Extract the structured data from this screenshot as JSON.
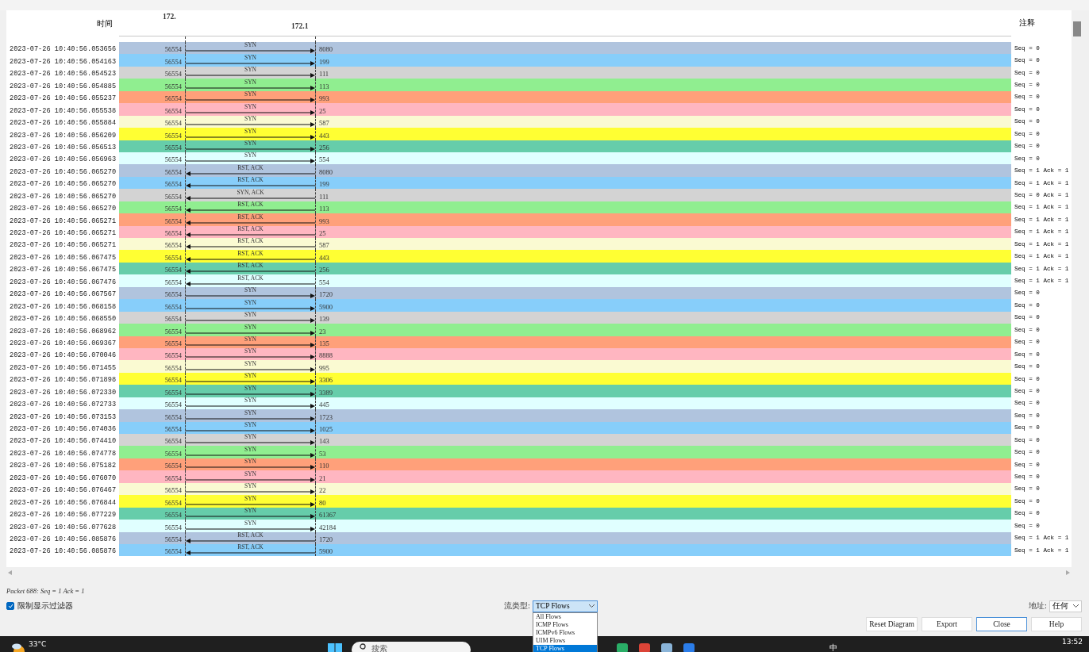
{
  "header": {
    "time_label": "时间",
    "hosts": [
      "172.",
      "172.1"
    ],
    "comment_label": "注释"
  },
  "flows": [
    {
      "time": "2023-07-26 10:40:56.053656",
      "src": "56554",
      "label": "SYN",
      "kind": "outbound",
      "dst": "8080",
      "comment": "Seq = 0",
      "color": "#b0c4de"
    },
    {
      "time": "2023-07-26 10:40:56.054163",
      "src": "56554",
      "label": "SYN",
      "kind": "outbound",
      "dst": "199",
      "comment": "Seq = 0",
      "color": "#87cefa"
    },
    {
      "time": "2023-07-26 10:40:56.054523",
      "src": "56554",
      "label": "SYN",
      "kind": "outbound",
      "dst": "111",
      "comment": "Seq = 0",
      "color": "#d3d3d3"
    },
    {
      "time": "2023-07-26 10:40:56.054885",
      "src": "56554",
      "label": "SYN",
      "kind": "outbound",
      "dst": "113",
      "comment": "Seq = 0",
      "color": "#90ee90"
    },
    {
      "time": "2023-07-26 10:40:56.055237",
      "src": "56554",
      "label": "SYN",
      "kind": "outbound",
      "dst": "993",
      "comment": "Seq = 0",
      "color": "#ffa07a"
    },
    {
      "time": "2023-07-26 10:40:56.055538",
      "src": "56554",
      "label": "SYN",
      "kind": "outbound",
      "dst": "25",
      "comment": "Seq = 0",
      "color": "#ffb6c1"
    },
    {
      "time": "2023-07-26 10:40:56.055884",
      "src": "56554",
      "label": "SYN",
      "kind": "outbound",
      "dst": "587",
      "comment": "Seq = 0",
      "color": "#fafad2"
    },
    {
      "time": "2023-07-26 10:40:56.056209",
      "src": "56554",
      "label": "SYN",
      "kind": "outbound",
      "dst": "443",
      "comment": "Seq = 0",
      "color": "#ffff33"
    },
    {
      "time": "2023-07-26 10:40:56.056513",
      "src": "56554",
      "label": "SYN",
      "kind": "outbound",
      "dst": "256",
      "comment": "Seq = 0",
      "color": "#66cdaa"
    },
    {
      "time": "2023-07-26 10:40:56.056963",
      "src": "56554",
      "label": "SYN",
      "kind": "outbound",
      "dst": "554",
      "comment": "Seq = 0",
      "color": "#e0ffff"
    },
    {
      "time": "2023-07-26 10:40:56.065270",
      "src": "56554",
      "label": "RST, ACK",
      "kind": "inbound",
      "dst": "8080",
      "comment": "Seq = 1 Ack = 1",
      "color": "#b0c4de"
    },
    {
      "time": "2023-07-26 10:40:56.065270",
      "src": "56554",
      "label": "RST, ACK",
      "kind": "inbound",
      "dst": "199",
      "comment": "Seq = 1 Ack = 1",
      "color": "#87cefa"
    },
    {
      "time": "2023-07-26 10:40:56.065270",
      "src": "56554",
      "label": "SYN, ACK",
      "kind": "inbound",
      "dst": "111",
      "comment": "Seq = 0 Ack = 1",
      "color": "#d3d3d3"
    },
    {
      "time": "2023-07-26 10:40:56.065270",
      "src": "56554",
      "label": "RST, ACK",
      "kind": "inbound",
      "dst": "113",
      "comment": "Seq = 1 Ack = 1",
      "color": "#90ee90"
    },
    {
      "time": "2023-07-26 10:40:56.065271",
      "src": "56554",
      "label": "RST, ACK",
      "kind": "inbound",
      "dst": "993",
      "comment": "Seq = 1 Ack = 1",
      "color": "#ffa07a"
    },
    {
      "time": "2023-07-26 10:40:56.065271",
      "src": "56554",
      "label": "RST, ACK",
      "kind": "inbound",
      "dst": "25",
      "comment": "Seq = 1 Ack = 1",
      "color": "#ffb6c1"
    },
    {
      "time": "2023-07-26 10:40:56.065271",
      "src": "56554",
      "label": "RST, ACK",
      "kind": "inbound",
      "dst": "587",
      "comment": "Seq = 1 Ack = 1",
      "color": "#fafad2"
    },
    {
      "time": "2023-07-26 10:40:56.067475",
      "src": "56554",
      "label": "RST, ACK",
      "kind": "inbound",
      "dst": "443",
      "comment": "Seq = 1 Ack = 1",
      "color": "#ffff33"
    },
    {
      "time": "2023-07-26 10:40:56.067475",
      "src": "56554",
      "label": "RST, ACK",
      "kind": "inbound",
      "dst": "256",
      "comment": "Seq = 1 Ack = 1",
      "color": "#66cdaa"
    },
    {
      "time": "2023-07-26 10:40:56.067476",
      "src": "56554",
      "label": "RST, ACK",
      "kind": "inbound",
      "dst": "554",
      "comment": "Seq = 1 Ack = 1",
      "color": "#e0ffff"
    },
    {
      "time": "2023-07-26 10:40:56.067567",
      "src": "56554",
      "label": "SYN",
      "kind": "outbound",
      "dst": "1720",
      "comment": "Seq = 0",
      "color": "#b0c4de"
    },
    {
      "time": "2023-07-26 10:40:56.068158",
      "src": "56554",
      "label": "SYN",
      "kind": "outbound",
      "dst": "5900",
      "comment": "Seq = 0",
      "color": "#87cefa"
    },
    {
      "time": "2023-07-26 10:40:56.068550",
      "src": "56554",
      "label": "SYN",
      "kind": "outbound",
      "dst": "139",
      "comment": "Seq = 0",
      "color": "#d3d3d3"
    },
    {
      "time": "2023-07-26 10:40:56.068962",
      "src": "56554",
      "label": "SYN",
      "kind": "outbound",
      "dst": "23",
      "comment": "Seq = 0",
      "color": "#90ee90"
    },
    {
      "time": "2023-07-26 10:40:56.069367",
      "src": "56554",
      "label": "SYN",
      "kind": "outbound",
      "dst": "135",
      "comment": "Seq = 0",
      "color": "#ffa07a"
    },
    {
      "time": "2023-07-26 10:40:56.070046",
      "src": "56554",
      "label": "SYN",
      "kind": "outbound",
      "dst": "8888",
      "comment": "Seq = 0",
      "color": "#ffb6c1"
    },
    {
      "time": "2023-07-26 10:40:56.071455",
      "src": "56554",
      "label": "SYN",
      "kind": "outbound",
      "dst": "995",
      "comment": "Seq = 0",
      "color": "#fafad2"
    },
    {
      "time": "2023-07-26 10:40:56.071898",
      "src": "56554",
      "label": "SYN",
      "kind": "outbound",
      "dst": "3306",
      "comment": "Seq = 0",
      "color": "#ffff33"
    },
    {
      "time": "2023-07-26 10:40:56.072330",
      "src": "56554",
      "label": "SYN",
      "kind": "outbound",
      "dst": "3389",
      "comment": "Seq = 0",
      "color": "#66cdaa"
    },
    {
      "time": "2023-07-26 10:40:56.072733",
      "src": "56554",
      "label": "SYN",
      "kind": "outbound",
      "dst": "445",
      "comment": "Seq = 0",
      "color": "#e0ffff"
    },
    {
      "time": "2023-07-26 10:40:56.073153",
      "src": "56554",
      "label": "SYN",
      "kind": "outbound",
      "dst": "1723",
      "comment": "Seq = 0",
      "color": "#b0c4de"
    },
    {
      "time": "2023-07-26 10:40:56.074036",
      "src": "56554",
      "label": "SYN",
      "kind": "outbound",
      "dst": "1025",
      "comment": "Seq = 0",
      "color": "#87cefa"
    },
    {
      "time": "2023-07-26 10:40:56.074410",
      "src": "56554",
      "label": "SYN",
      "kind": "outbound",
      "dst": "143",
      "comment": "Seq = 0",
      "color": "#d3d3d3"
    },
    {
      "time": "2023-07-26 10:40:56.074778",
      "src": "56554",
      "label": "SYN",
      "kind": "outbound",
      "dst": "53",
      "comment": "Seq = 0",
      "color": "#90ee90"
    },
    {
      "time": "2023-07-26 10:40:56.075182",
      "src": "56554",
      "label": "SYN",
      "kind": "outbound",
      "dst": "110",
      "comment": "Seq = 0",
      "color": "#ffa07a"
    },
    {
      "time": "2023-07-26 10:40:56.076070",
      "src": "56554",
      "label": "SYN",
      "kind": "outbound",
      "dst": "21",
      "comment": "Seq = 0",
      "color": "#ffb6c1"
    },
    {
      "time": "2023-07-26 10:40:56.076467",
      "src": "56554",
      "label": "SYN",
      "kind": "outbound",
      "dst": "22",
      "comment": "Seq = 0",
      "color": "#fafad2"
    },
    {
      "time": "2023-07-26 10:40:56.076844",
      "src": "56554",
      "label": "SYN",
      "kind": "outbound",
      "dst": "80",
      "comment": "Seq = 0",
      "color": "#ffff33"
    },
    {
      "time": "2023-07-26 10:40:56.077229",
      "src": "56554",
      "label": "SYN",
      "kind": "outbound",
      "dst": "61367",
      "comment": "Seq = 0",
      "color": "#66cdaa"
    },
    {
      "time": "2023-07-26 10:40:56.077628",
      "src": "56554",
      "label": "SYN",
      "kind": "outbound",
      "dst": "42184",
      "comment": "Seq = 0",
      "color": "#e0ffff"
    },
    {
      "time": "2023-07-26 10:40:56.085876",
      "src": "56554",
      "label": "RST, ACK",
      "kind": "inbound",
      "dst": "1720",
      "comment": "Seq = 1 Ack = 1",
      "color": "#b0c4de"
    },
    {
      "time": "2023-07-26 10:40:56.085876",
      "src": "56554",
      "label": "RST, ACK",
      "kind": "inbound",
      "dst": "5900",
      "comment": "Seq = 1 Ack = 1",
      "color": "#87cefa"
    }
  ],
  "status": "Packet 688: Seq = 1 Ack = 1",
  "limit_filter": {
    "label": "限制显示过滤器",
    "checked": true
  },
  "flow_type": {
    "label": "流类型:",
    "value": "TCP Flows",
    "expanded": true,
    "options": [
      {
        "label": "All Flows",
        "selected": false
      },
      {
        "label": "ICMP Flows",
        "selected": false
      },
      {
        "label": "ICMPv6 Flows",
        "selected": false
      },
      {
        "label": "UIM Flows",
        "selected": false
      },
      {
        "label": "TCP Flows",
        "selected": true
      }
    ]
  },
  "address": {
    "label": "地址:",
    "value": "任何"
  },
  "buttons": [
    {
      "label": "Reset Diagram",
      "focused": false
    },
    {
      "label": "Export",
      "focused": false
    },
    {
      "label": "Close",
      "focused": true
    },
    {
      "label": "Help",
      "focused": false
    }
  ],
  "taskbar": {
    "weather": "33°C",
    "search_placeholder": "搜索",
    "ime": "中",
    "clock": "13:52"
  }
}
